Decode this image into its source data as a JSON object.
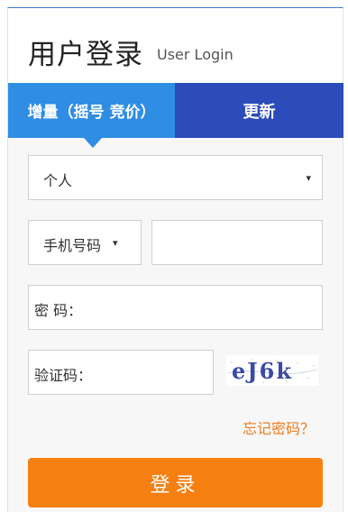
{
  "header": {
    "title": "用户登录",
    "subtitle": "User Login"
  },
  "tabs": [
    {
      "label": "增量（摇号 竞价）",
      "active": true
    },
    {
      "label": "更新",
      "active": false
    }
  ],
  "form": {
    "user_type": {
      "value": "个人",
      "caret": "▾"
    },
    "id_type": {
      "value": "手机号码",
      "caret": "▾"
    },
    "phone": {
      "value": ""
    },
    "password": {
      "label": "密 码："
    },
    "verify": {
      "label": "验证码："
    },
    "captcha": {
      "text": "eJ6k"
    },
    "forgot": "忘记密码？",
    "submit": "登录"
  },
  "colors": {
    "tab_active": "#2f8de4",
    "tab_inactive": "#2c4cba",
    "submit": "#f67f12",
    "forgot": "#f07c1c"
  }
}
